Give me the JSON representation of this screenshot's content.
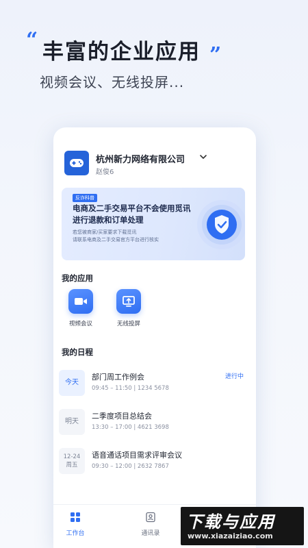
{
  "hero": {
    "quote_open": "“",
    "quote_close": "”",
    "title": "丰富的企业应用",
    "subtitle": "视频会议、无线投屏..."
  },
  "company": {
    "name": "杭州新力网络有限公司",
    "user": "赵俊6",
    "logo_icon": "gamepad-icon",
    "chevron_icon": "chevron-down-icon"
  },
  "banner": {
    "tag": "反诈科普",
    "title": "电商及二手交易平台不会使用觅讯进行退款和订单处理",
    "desc_line1": "若您被商家/买家要求下载觅讯",
    "desc_line2": "请联系电商及二手交易官方平台进行核实",
    "icon": "shield-check-icon"
  },
  "my_apps": {
    "title": "我的应用",
    "items": [
      {
        "label": "视频会议",
        "icon": "video-camera-icon"
      },
      {
        "label": "无线投屏",
        "icon": "screen-cast-icon"
      }
    ]
  },
  "schedule": {
    "title": "我的日程",
    "items": [
      {
        "date": "今天",
        "date2": "",
        "title": "部门周工作例会",
        "meta": "09:45 – 11:50 | 1234 5678",
        "status": "进行中"
      },
      {
        "date": "明天",
        "date2": "",
        "title": "二季度项目总结会",
        "meta": "13:30 – 17:00 | 4621 3698",
        "status": ""
      },
      {
        "date": "12-24",
        "date2": "周五",
        "title": "语音通话项目需求评审会议",
        "meta": "09:30 – 12:00 | 2632 7867",
        "status": ""
      }
    ]
  },
  "tabbar": {
    "items": [
      {
        "label": "工作台",
        "icon": "grid-icon",
        "active": true
      },
      {
        "label": "通讯录",
        "icon": "contacts-icon",
        "active": false
      }
    ]
  },
  "watermark": {
    "big": "下载与应用",
    "small": "www.xiazaiziao.com"
  },
  "colors": {
    "accent": "#2f6ef2",
    "background": "#eef2fb",
    "text": "#1f2430"
  }
}
